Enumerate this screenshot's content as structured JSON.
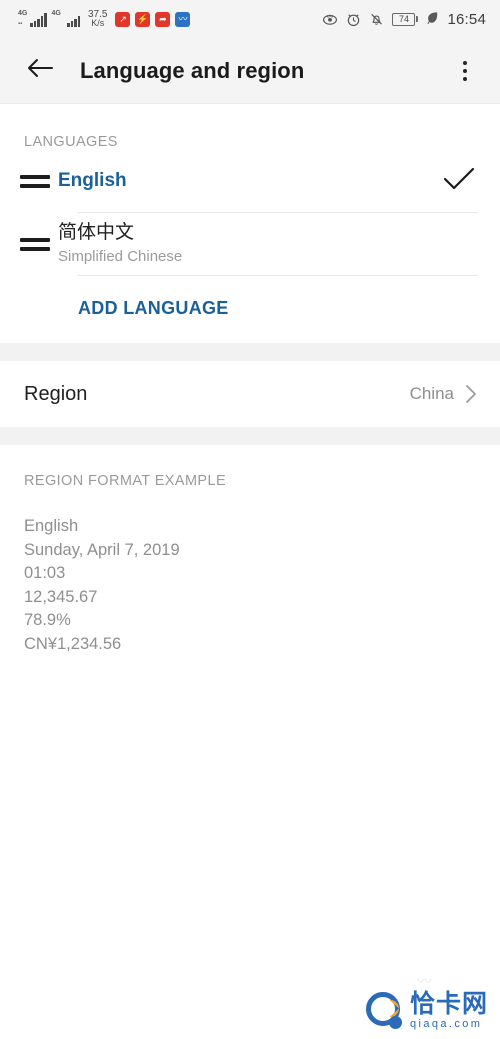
{
  "status_bar": {
    "signal_1": {
      "icon": "signal-bars-icon",
      "network": "4G"
    },
    "signal_2": {
      "icon": "signal-bars-icon",
      "network": "4G"
    },
    "net_speed": {
      "value": "37.5",
      "unit": "K/s"
    },
    "notification_icons": [
      {
        "name": "notification-app-icon-1",
        "color": "#e2362b",
        "glyph": "↗"
      },
      {
        "name": "notification-app-icon-2",
        "color": "#e2362b",
        "glyph": "⚡"
      },
      {
        "name": "notification-app-icon-3",
        "color": "#e2362b",
        "glyph": "➦"
      },
      {
        "name": "notification-app-icon-4",
        "color": "#2d72c4",
        "glyph": "〰"
      }
    ],
    "eye_comfort_icon": "ʘ",
    "alarm_icon": "⏰",
    "silent_icon": "🔕",
    "battery": {
      "level": "74"
    },
    "power_saving_icon": "leaf-icon",
    "time": "16:54"
  },
  "app_bar": {
    "back_icon": "arrow-left-icon",
    "title": "Language and region",
    "overflow_icon": "more-vertical-icon"
  },
  "languages_section": {
    "header": "LANGUAGES",
    "items": [
      {
        "name": "English",
        "subtitle": "",
        "selected": true,
        "drag_handle": "drag-handle-icon",
        "check_icon": "check-icon"
      },
      {
        "name": "简体中文",
        "subtitle": "Simplified Chinese",
        "selected": false,
        "drag_handle": "drag-handle-icon",
        "check_icon": ""
      }
    ],
    "add_language_label": "ADD LANGUAGE"
  },
  "region_section": {
    "label": "Region",
    "value": "China",
    "chevron_icon": "chevron-right-icon"
  },
  "region_format_section": {
    "header": "REGION FORMAT EXAMPLE",
    "lines": [
      "English",
      "Sunday, April 7, 2019",
      "01:03",
      "12,345.67",
      "78.9%",
      "CN¥1,234.56"
    ]
  },
  "watermark": {
    "cn_text": "恰卡网",
    "en_text": "qiaqa.com",
    "color": "#1f63b5"
  },
  "colors": {
    "accent_blue": "#1c6099",
    "status_bar_bg": "#f4f4f4",
    "gap_bg": "#f2f2f2",
    "muted_text": "#9a9a9a"
  }
}
